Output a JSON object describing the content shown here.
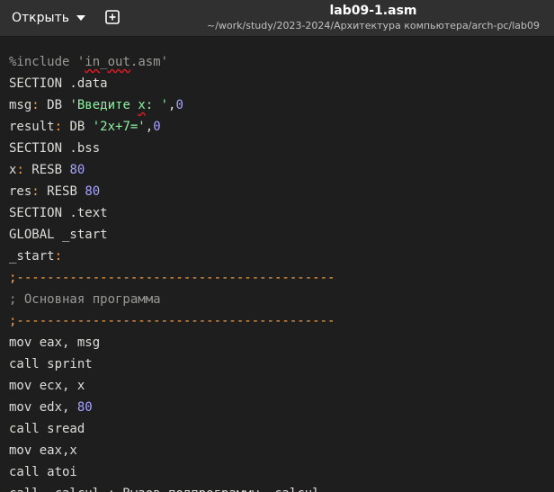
{
  "header": {
    "open_label": "Открыть",
    "title": "lab09-1.asm",
    "path": "~/work/study/2023-2024/Архитектура компьютера/arch-pc/lab09"
  },
  "code": {
    "l1_include": "%include ",
    "l1_file_q1": "'",
    "l1_file_a": "in",
    "l1_file_b": "_",
    "l1_file_c": "out",
    "l1_file_d": ".asm'",
    "l2": "SECTION .data",
    "l3_a": "msg",
    "l3_b": ":",
    "l3_c": " DB ",
    "l3_d": "'Введите ",
    "l3_e": "x",
    "l3_f": ": '",
    "l3_g": ",",
    "l3_h": "0",
    "l4_a": "result",
    "l4_b": ":",
    "l4_c": " DB ",
    "l4_d": "'2x+7='",
    "l4_e": ",",
    "l4_f": "0",
    "l5": "SECTION .bss",
    "l6_a": "x",
    "l6_b": ":",
    "l6_c": " RESB ",
    "l6_d": "80",
    "l7_a": "res",
    "l7_b": ":",
    "l7_c": " RESB ",
    "l7_d": "80",
    "l8": "SECTION .text",
    "l9": "GLOBAL _start",
    "l10_a": "_start",
    "l10_b": ":",
    "l11": ";------------------------------------------",
    "l12": "; Основная программа",
    "l13": ";------------------------------------------",
    "l14": "mov eax, msg",
    "l15": "call sprint",
    "l16": "mov ecx, x",
    "l17_a": "mov edx, ",
    "l17_b": "80",
    "l18": "call sread",
    "l19": "mov eax,x",
    "l20": "call atoi",
    "l21": "call _calcul ; Вызов подпрограммы _calcul"
  },
  "colors": {
    "background": "#1e1e1e",
    "header": "#303030",
    "text": "#deddda",
    "comment": "#9a9996",
    "string": "#8ff0a4",
    "number": "#a6a3ff",
    "label": "#ffa348"
  },
  "icons": {
    "new_tab": "new-tab-icon",
    "dropdown": "chevron-down-icon"
  }
}
